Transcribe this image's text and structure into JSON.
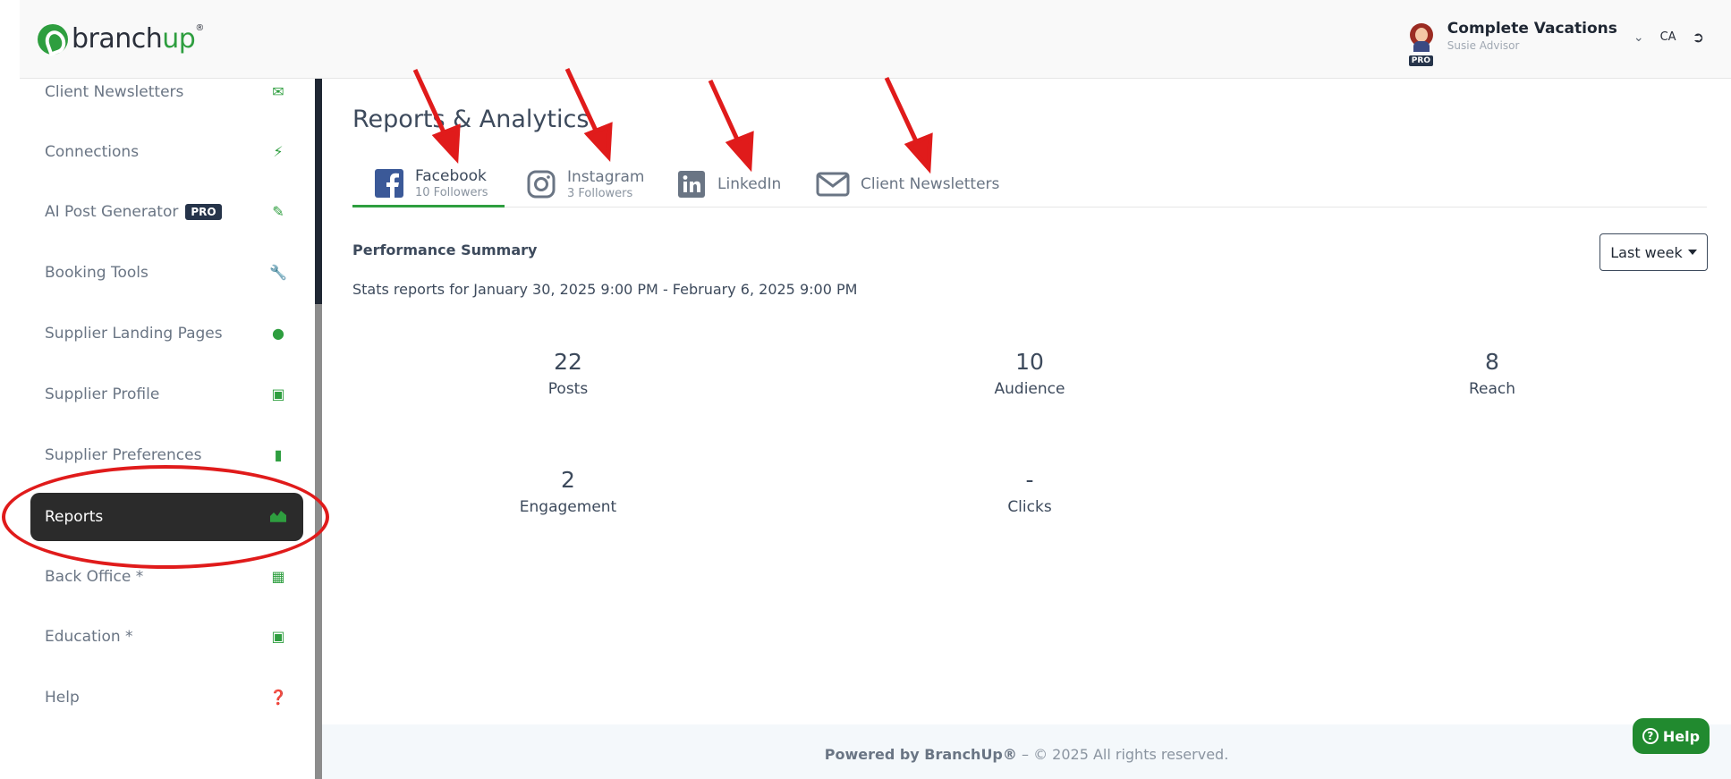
{
  "header": {
    "logo_text_branch": "branch",
    "logo_text_up": "up",
    "account_name": "Complete Vacations",
    "account_role": "Susie Advisor",
    "pro_badge": "PRO",
    "language": "CA"
  },
  "sidebar": {
    "items": [
      {
        "label": "Client Newsletters",
        "icon": "envelope-icon"
      },
      {
        "label": "Connections",
        "icon": "plug-icon"
      },
      {
        "label": "AI Post Generator",
        "icon": "edit-icon",
        "badge": "PRO"
      },
      {
        "label": "Booking Tools",
        "icon": "wrench-icon"
      },
      {
        "label": "Supplier Landing Pages",
        "icon": "globe-icon"
      },
      {
        "label": "Supplier Profile",
        "icon": "book-icon"
      },
      {
        "label": "Supplier Preferences",
        "icon": "bookmark-icon"
      },
      {
        "label": "Reports",
        "icon": "area-chart-icon",
        "active": true
      },
      {
        "label": "Back Office *",
        "icon": "map-icon"
      },
      {
        "label": "Education *",
        "icon": "book-icon"
      },
      {
        "label": "Help",
        "icon": "question-icon"
      }
    ]
  },
  "main": {
    "title": "Reports & Analytics",
    "tabs": [
      {
        "label": "Facebook",
        "sub": "10 Followers",
        "icon": "facebook-icon",
        "active": true
      },
      {
        "label": "Instagram",
        "sub": "3 Followers",
        "icon": "instagram-icon"
      },
      {
        "label": "LinkedIn",
        "icon": "linkedin-icon"
      },
      {
        "label": "Client Newsletters",
        "icon": "envelope-icon"
      }
    ],
    "performance_title": "Performance Summary",
    "range_text": "Stats reports for January 30, 2025 9:00 PM - February 6, 2025 9:00 PM",
    "period_selector": "Last week",
    "stats": [
      {
        "value": "22",
        "label": "Posts"
      },
      {
        "value": "10",
        "label": "Audience"
      },
      {
        "value": "8",
        "label": "Reach"
      },
      {
        "value": "2",
        "label": "Engagement"
      },
      {
        "value": "-",
        "label": "Clicks"
      }
    ]
  },
  "footer": {
    "powered": "Powered by BranchUp®",
    "rights": " – © 2025 All rights reserved."
  },
  "help_button": "Help",
  "colors": {
    "accent": "#2e9e3f",
    "active_bg": "#2b2b2b",
    "annotation": "#e01b1b",
    "text": "#3d4a5c"
  }
}
